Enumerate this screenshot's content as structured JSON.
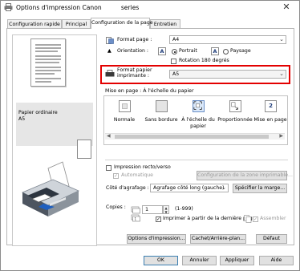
{
  "window": {
    "title": "Options d'impression Canon",
    "title_suffix": "series",
    "close_glyph": "✕"
  },
  "tabs": [
    {
      "label": "Configuration rapide"
    },
    {
      "label": "Principal"
    },
    {
      "label": "Configuration de la page",
      "active": true
    },
    {
      "label": "Entretien"
    }
  ],
  "preview": {
    "media_name": "Papier ordinaire",
    "media_size": "A5"
  },
  "page_size": {
    "label": "Format page :",
    "value": "A4"
  },
  "orientation": {
    "label": "Orientation :",
    "portrait": "Portrait",
    "paysage": "Paysage",
    "rotate_label": "Rotation 180 degrés",
    "selected": "Portrait"
  },
  "printer_paper": {
    "label_line1": "Format papier",
    "label_line2": "imprimante :",
    "value": "A5"
  },
  "layout": {
    "label": "Mise en page :",
    "current": "À l'échelle du papier",
    "items": [
      {
        "label": "Normale",
        "icon": "normal-layout-icon"
      },
      {
        "label": "Sans bordure",
        "icon": "borderless-layout-icon"
      },
      {
        "label": "À l'échelle du papier",
        "icon": "fit-to-page-icon",
        "selected": true
      },
      {
        "label": "Proportionnée",
        "icon": "scaled-layout-icon"
      },
      {
        "label": "Mise en page",
        "icon": "page-layout-icon",
        "number": "2"
      }
    ]
  },
  "duplex": {
    "label": "Impression recto/verso",
    "auto_label": "Automatique",
    "config_button": "Configuration de la zone imprimable..."
  },
  "stapling": {
    "label": "Côté d'agrafage :",
    "value": "Agrafage côté long (gauche)",
    "margin_button": "Spécifier la marge..."
  },
  "copies": {
    "label": "Copies :",
    "value": "1",
    "range": "(1-999)",
    "last_page_label": "Imprimer à partir de la dernière page",
    "collate_label": "Assembler",
    "check_glyph": "✓"
  },
  "bottom_buttons": {
    "print_options": "Options d'impression...",
    "stamp_bg": "Cachet/Arrière-plan...",
    "default": "Défaut"
  },
  "dialog_buttons": {
    "ok": "OK",
    "cancel": "Annuler",
    "apply": "Appliquer",
    "help": "Aide"
  },
  "colors": {
    "highlight_border": "#e30000",
    "selected_layout_bg": "#dbe9fa"
  }
}
